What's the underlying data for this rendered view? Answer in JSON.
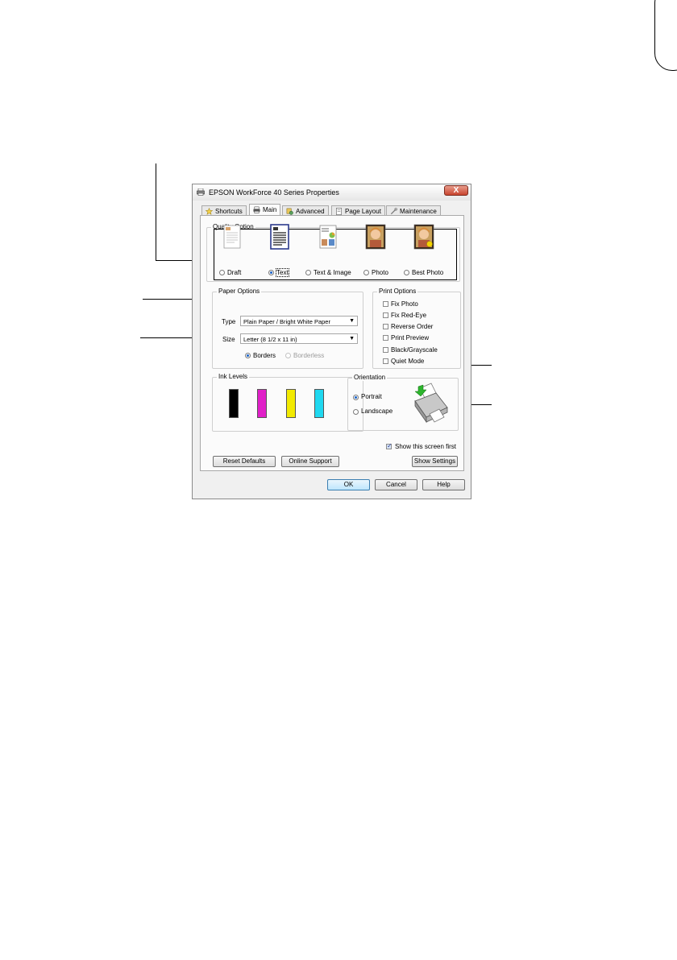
{
  "window": {
    "title": "EPSON WorkForce 40 Series Properties",
    "close_label": "X"
  },
  "tabs": [
    {
      "label": "Shortcuts"
    },
    {
      "label": "Main"
    },
    {
      "label": "Advanced"
    },
    {
      "label": "Page Layout"
    },
    {
      "label": "Maintenance"
    }
  ],
  "quality": {
    "title": "Quality Option",
    "options": [
      {
        "label": "Draft"
      },
      {
        "label": "Text"
      },
      {
        "label": "Text & Image"
      },
      {
        "label": "Photo"
      },
      {
        "label": "Best Photo"
      }
    ],
    "selected": "Text"
  },
  "paper": {
    "title": "Paper Options",
    "type_label": "Type",
    "type_value": "Plain Paper / Bright White Paper",
    "size_label": "Size",
    "size_value": "Letter (8 1/2 x 11 in)",
    "borders_label": "Borders",
    "borderless_label": "Borderless",
    "selected": "Borders"
  },
  "print_options": {
    "title": "Print Options",
    "items": [
      {
        "label": "Fix Photo",
        "checked": false
      },
      {
        "label": "Fix Red-Eye",
        "checked": false
      },
      {
        "label": "Reverse Order",
        "checked": false
      },
      {
        "label": "Print Preview",
        "checked": false
      },
      {
        "label": "Black/Grayscale",
        "checked": false
      },
      {
        "label": "Quiet Mode",
        "checked": false
      }
    ]
  },
  "ink": {
    "title": "Ink Levels",
    "colors": [
      "#000000",
      "#e020c8",
      "#f2ea00",
      "#1fd8f0"
    ]
  },
  "orientation": {
    "title": "Orientation",
    "portrait_label": "Portrait",
    "landscape_label": "Landscape",
    "selected": "Portrait"
  },
  "show_screen": {
    "label": "Show this screen first",
    "checked": true
  },
  "buttons": {
    "reset_defaults": "Reset Defaults",
    "online_support": "Online Support",
    "show_settings": "Show Settings",
    "ok": "OK",
    "cancel": "Cancel",
    "help": "Help"
  }
}
